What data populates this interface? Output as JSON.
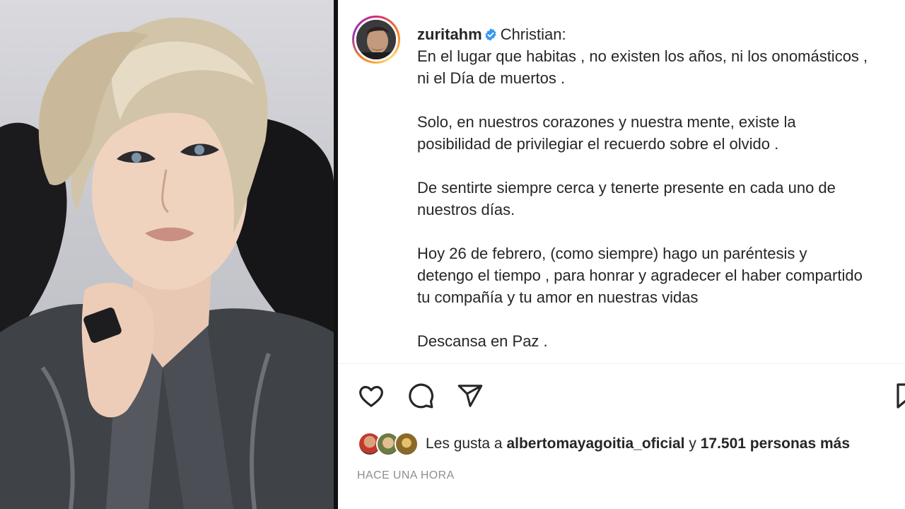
{
  "post": {
    "username": "zuritahm",
    "caption_lines": [
      "Christian:",
      "En el lugar que habitas , no existen los años, ni los onomásticos ,",
      "ni el Día de muertos .",
      "",
      "Solo, en nuestros corazones y nuestra mente, existe la",
      "posibilidad de privilegiar el recuerdo sobre el olvido .",
      "",
      "De sentirte siempre cerca y tenerte presente en cada uno de",
      "nuestros días.",
      "",
      "Hoy 26 de febrero, (como siempre) hago un paréntesis y",
      "detengo el tiempo , para honrar y agradecer el haber compartido",
      "tu compañía y tu amor en nuestras vidas",
      "",
      "Descansa en Paz ."
    ],
    "likes": {
      "prefix": "Les gusta a ",
      "user": "albertomayagoitia_oficial",
      "middle": " y ",
      "count_text": "17.501 personas más"
    },
    "timestamp": "HACE UNA HORA"
  },
  "icons": {
    "like": "heart-icon",
    "comment": "comment-icon",
    "share": "share-icon",
    "save": "bookmark-icon",
    "verified": "verified-badge-icon"
  },
  "colors": {
    "verified_blue": "#3897f0",
    "text": "#262626",
    "muted": "#8e8e8e"
  }
}
